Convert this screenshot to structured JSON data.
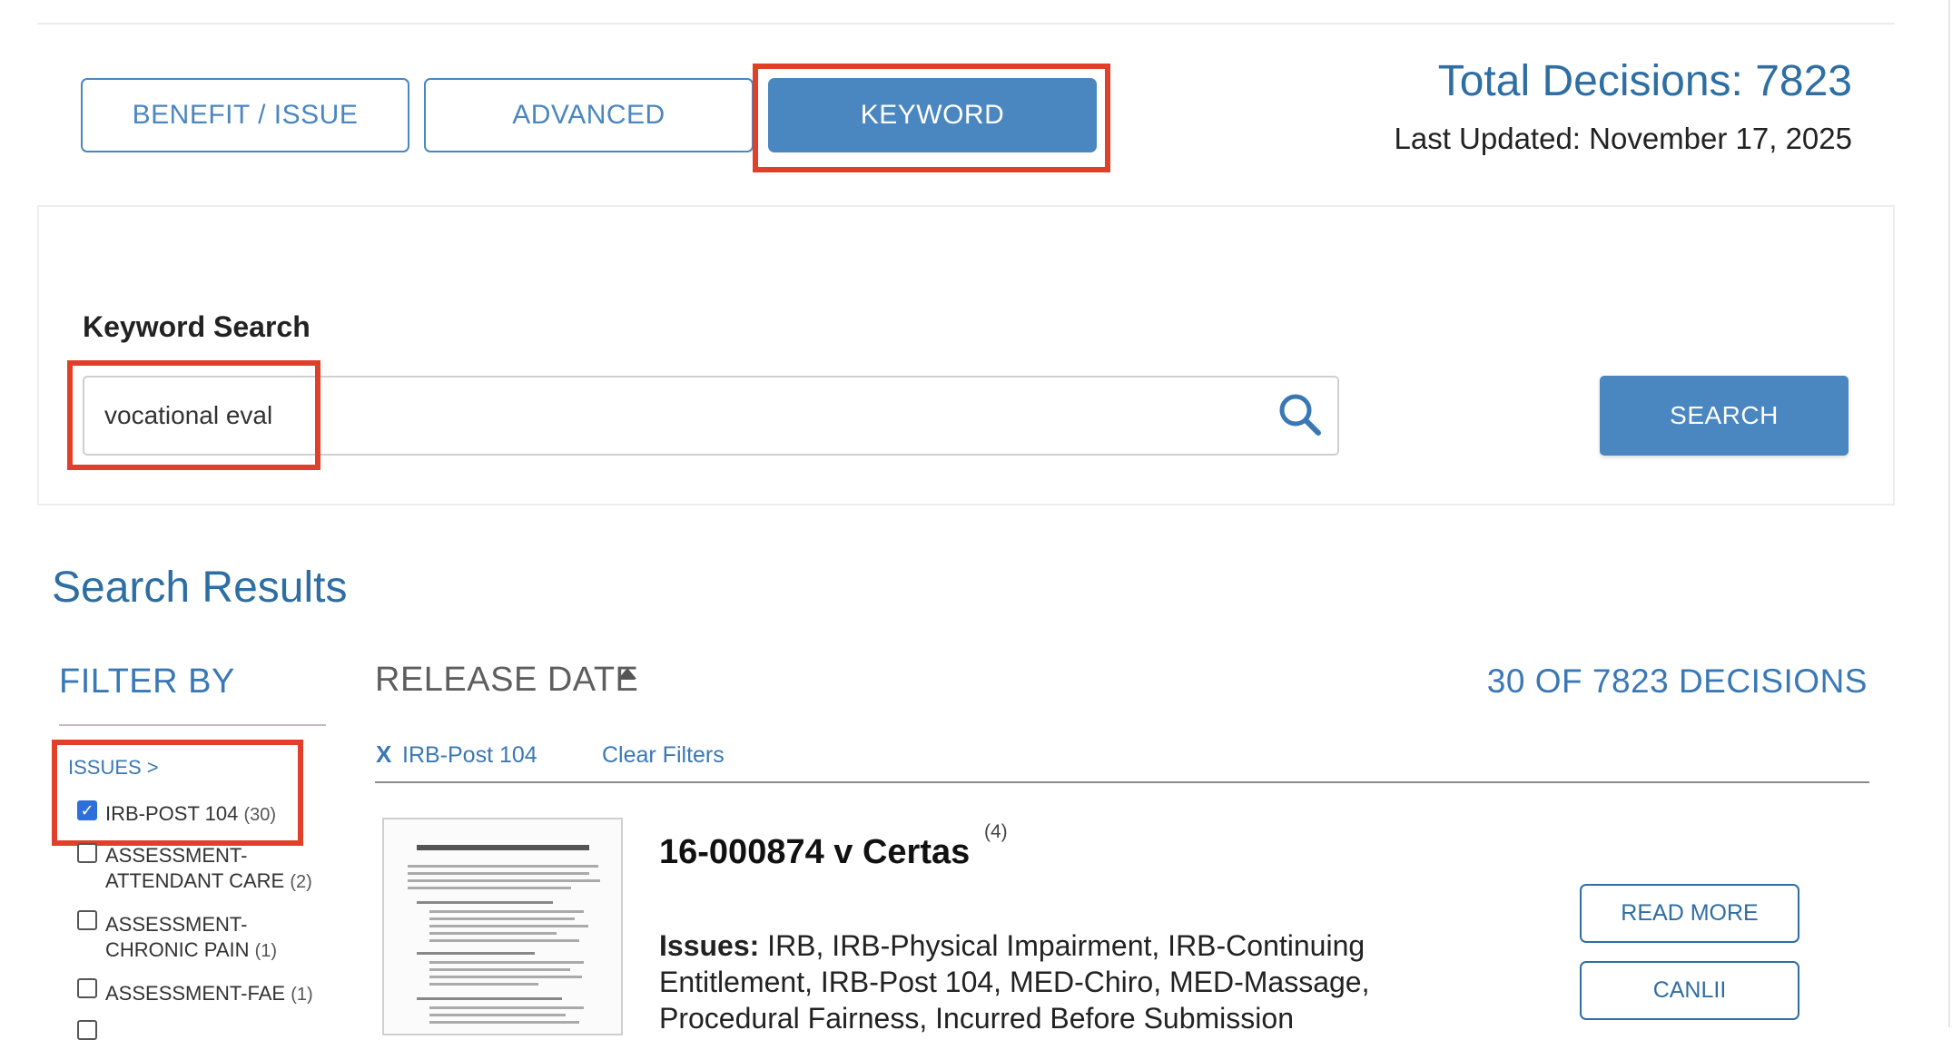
{
  "tabs": [
    {
      "label": "BENEFIT / ISSUE",
      "active": false
    },
    {
      "label": "ADVANCED",
      "active": false
    },
    {
      "label": "KEYWORD",
      "active": true
    }
  ],
  "stats": {
    "total_decisions": "Total Decisions: 7823",
    "last_updated": "Last Updated: November 17, 2025"
  },
  "search": {
    "label": "Keyword Search",
    "value": "vocational eval",
    "button": "SEARCH",
    "icon": "search-icon"
  },
  "results": {
    "title": "Search Results",
    "sort_label": "RELEASE DATE",
    "sort_direction": "ascending",
    "count_text": "30 OF 7823 DECISIONS",
    "active_filter": {
      "remove_glyph": "X",
      "label": "IRB-Post 104"
    },
    "clear_filters": "Clear Filters",
    "items": [
      {
        "title": "16-000874 v Certas",
        "superscript": "(4)",
        "issues_label": "Issues:",
        "issues_text": "IRB, IRB-Physical Impairment, IRB-Continuing Entitlement, IRB-Post 104, MED-Chiro, MED-Massage, Procedural Fairness, Incurred Before Submission",
        "read_more": "READ MORE",
        "canlii": "CANLII"
      }
    ]
  },
  "filter": {
    "title": "FILTER BY",
    "issues_header": "ISSUES >",
    "options": [
      {
        "label": "IRB-Post 104",
        "count": "(30)",
        "checked": true
      },
      {
        "label": "Assessment-",
        "label2": "Attendant Care",
        "count": "(2)",
        "checked": false
      },
      {
        "label": "Assessment-",
        "label2": "Chronic Pain",
        "count": "(1)",
        "checked": false
      },
      {
        "label": "Assessment-FAE",
        "count": "(1)",
        "checked": false
      }
    ]
  },
  "colors": {
    "primary": "#4a86c0",
    "link": "#3a78b5",
    "highlight": "#e0402a"
  }
}
